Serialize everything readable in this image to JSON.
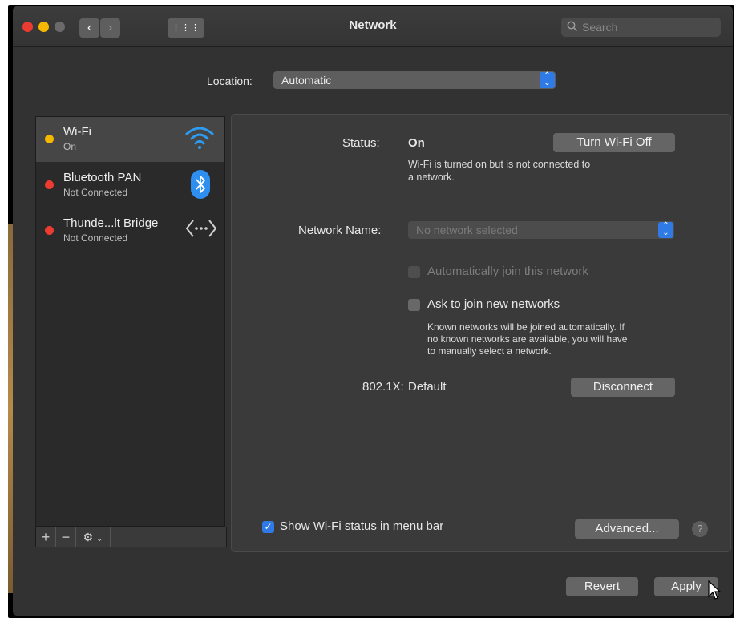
{
  "window": {
    "title": "Network"
  },
  "toolbar": {
    "search_placeholder": "Search",
    "back": "‹",
    "forward": "›",
    "grid": "⋮⋮⋮"
  },
  "location": {
    "label": "Location:",
    "value": "Automatic"
  },
  "services": [
    {
      "name": "Wi-Fi",
      "status": "On",
      "dot_color": "#f5b800",
      "icon": "wifi-icon"
    },
    {
      "name": "Bluetooth PAN",
      "status": "Not Connected",
      "dot_color": "#ec3b30",
      "icon": "bluetooth-icon"
    },
    {
      "name": "Thunde...lt Bridge",
      "status": "Not Connected",
      "dot_color": "#ec3b30",
      "icon": "thunderbolt-bridge-icon"
    }
  ],
  "sidebar_tools": {
    "add": "+",
    "remove": "−",
    "action": "⚙"
  },
  "detail": {
    "status_label": "Status:",
    "status_value": "On",
    "turn_off_button": "Turn Wi-Fi Off",
    "status_desc_line1": "Wi-Fi is turned on but is not connected to",
    "status_desc_line2": "a network.",
    "network_name_label": "Network Name:",
    "network_name_placeholder": "No network selected",
    "auto_join_label": "Automatically join this network",
    "ask_join_label": "Ask to join new networks",
    "ask_desc_line1": "Known networks will be joined automatically. If",
    "ask_desc_line2": "no known networks are available, you will have",
    "ask_desc_line3": "to manually select a network.",
    "dot1x_label": "802.1X:",
    "dot1x_value": "Default",
    "disconnect_button": "Disconnect",
    "show_status_label": "Show Wi-Fi status in menu bar",
    "show_status_checked": true,
    "advanced_button": "Advanced...",
    "help": "?"
  },
  "footer": {
    "revert_button": "Revert",
    "apply_button": "Apply"
  }
}
